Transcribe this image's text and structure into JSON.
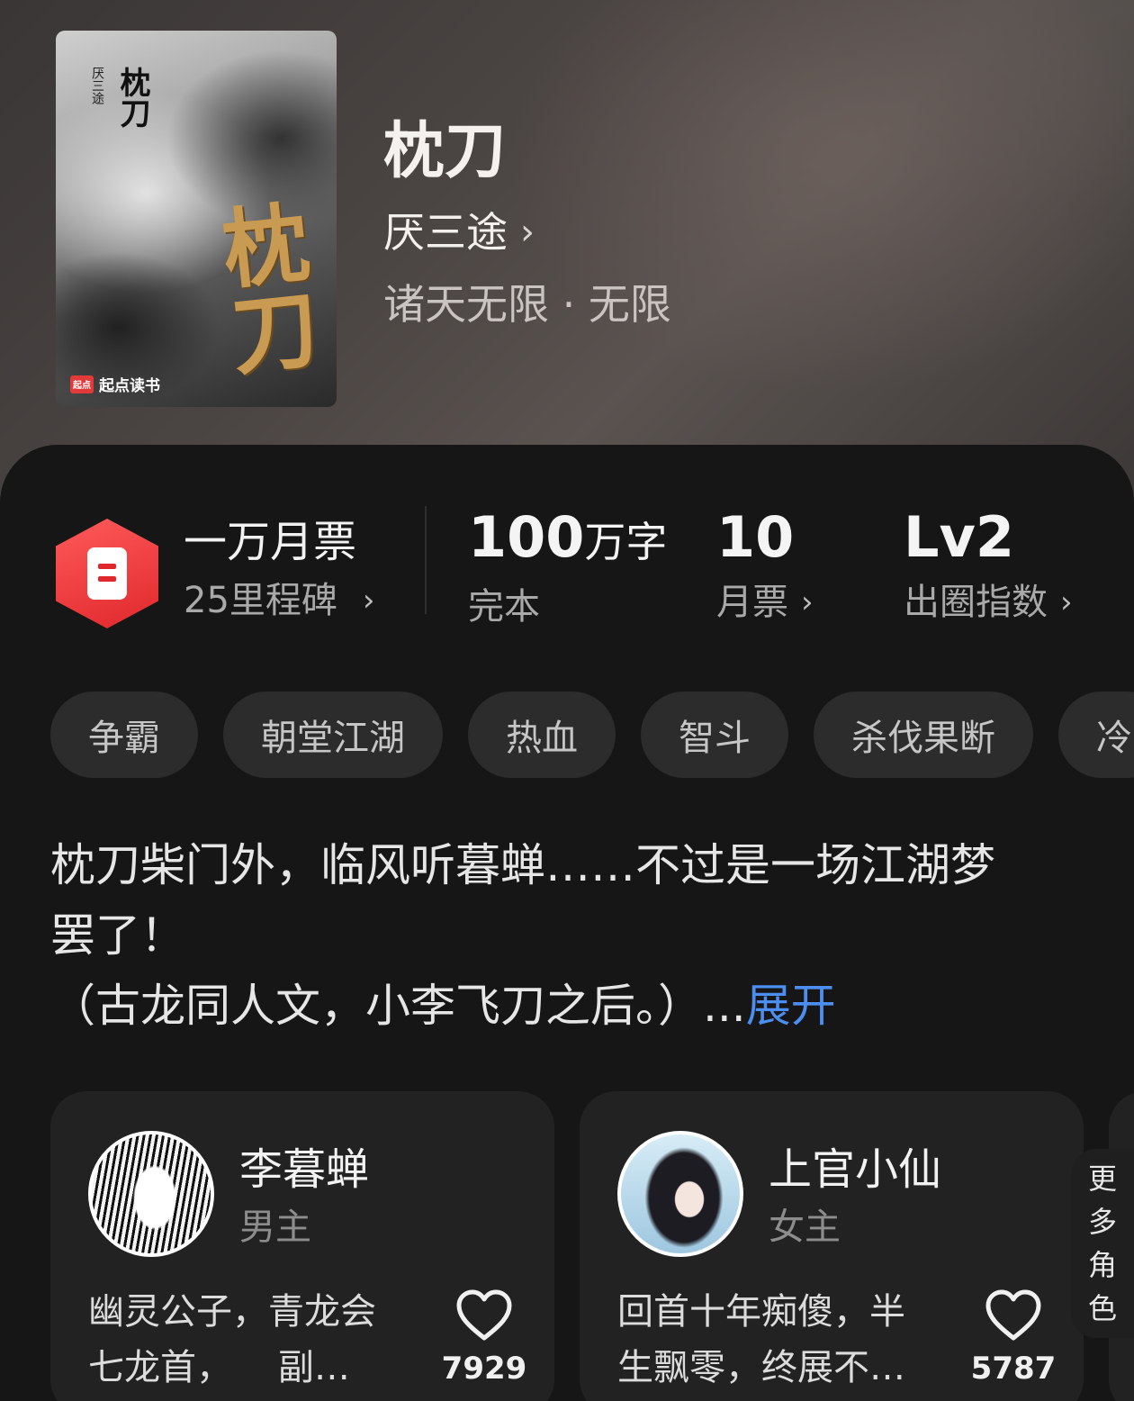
{
  "book": {
    "title": "枕刀",
    "author": "厌三途",
    "genre": "诸天无限 · 无限",
    "cover": {
      "small_title": "枕刀",
      "small_author": "厌三途",
      "big_title": "枕刀",
      "brand": "起点读书",
      "brand_logo": "起点"
    }
  },
  "stats": {
    "milestone_title": "一万月票",
    "milestone_sub": "25里程碑",
    "words_value": "100",
    "words_unit": "万字",
    "words_label": "完本",
    "monthly_value": "10",
    "monthly_label": "月票",
    "index_value": "Lv2",
    "index_label": "出圈指数"
  },
  "tags": [
    "争霸",
    "朝堂江湖",
    "热血",
    "智斗",
    "杀伐果断",
    "冷"
  ],
  "description": {
    "line1": "枕刀柴门外，临风听暮蝉……不过是一场江湖梦",
    "line2": "罢了！",
    "line3": "（古龙同人文，小李飞刀之后。）...",
    "expand": "展开"
  },
  "characters": [
    {
      "name": "李暮蝉",
      "role": "男主",
      "desc_line1": "幽灵公子，青龙会",
      "desc_line2": "七龙首，    副…",
      "likes": "7929"
    },
    {
      "name": "上官小仙",
      "role": "女主",
      "desc_line1": "回首十年痴傻，半",
      "desc_line2": "生飘零，终展不…",
      "likes": "5787"
    }
  ],
  "more_roles": [
    "更",
    "多",
    "角",
    "色"
  ],
  "icons": {
    "chevron": "chevron-right-icon",
    "ticket": "ticket-icon",
    "heart": "heart-outline-icon"
  },
  "colors": {
    "accent_red": "#e0282c",
    "link_blue": "#4b8ef0",
    "background": "#161616"
  }
}
